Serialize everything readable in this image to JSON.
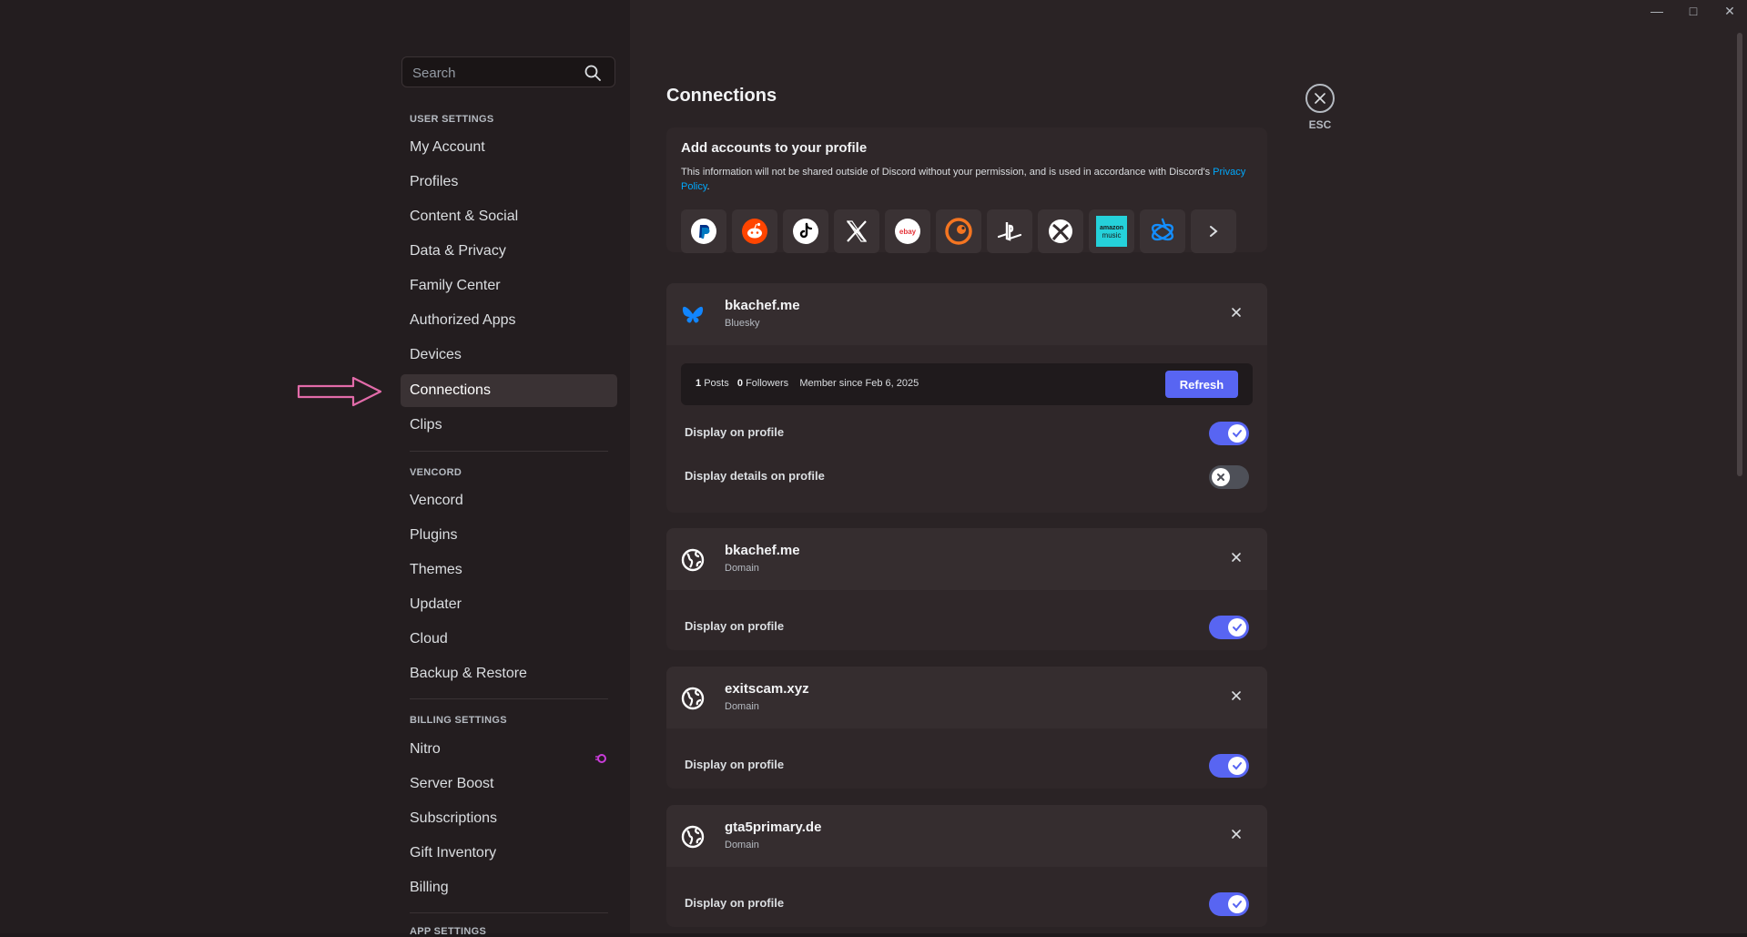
{
  "search": {
    "placeholder": "Search"
  },
  "sidebar": {
    "user_settings_title": "USER SETTINGS",
    "user_items": [
      "My Account",
      "Profiles",
      "Content & Social",
      "Data & Privacy",
      "Family Center",
      "Authorized Apps",
      "Devices",
      "Connections",
      "Clips"
    ],
    "vencord_title": "VENCORD",
    "vencord_items": [
      "Vencord",
      "Plugins",
      "Themes",
      "Updater",
      "Cloud",
      "Backup & Restore"
    ],
    "billing_title": "BILLING SETTINGS",
    "billing_items": [
      "Nitro",
      "Server Boost",
      "Subscriptions",
      "Gift Inventory",
      "Billing"
    ],
    "app_settings_title": "APP SETTINGS",
    "active_item": "Connections"
  },
  "page": {
    "title": "Connections",
    "esc_label": "ESC"
  },
  "add_accounts": {
    "title": "Add accounts to your profile",
    "description": "This information will not be shared outside of Discord without your permission, and is used in accordance with Discord's",
    "privacy_link": "Privacy Policy",
    "period": ".",
    "services": [
      "paypal-icon",
      "reddit-icon",
      "tiktok-icon",
      "x-icon",
      "ebay-icon",
      "crunchyroll-icon",
      "playstation-icon",
      "xbox-icon",
      "amazon-music-icon",
      "battlenet-icon",
      "chevron-right-icon"
    ],
    "ebay_text": "ebay",
    "amazon_text": "amazon",
    "amazon_sub": "music"
  },
  "connections": [
    {
      "name": "bkachef.me",
      "type": "Bluesky",
      "stats": {
        "posts": "1",
        "posts_label": "Posts",
        "followers": "0",
        "followers_label": "Followers",
        "member_since": "Member since Feb 6, 2025"
      },
      "refresh_label": "Refresh",
      "display_on_profile_label": "Display on profile",
      "display_on_profile": true,
      "display_details_label": "Display details on profile",
      "display_details": false
    },
    {
      "name": "bkachef.me",
      "type": "Domain",
      "display_on_profile_label": "Display on profile",
      "display_on_profile": true
    },
    {
      "name": "exitscam.xyz",
      "type": "Domain",
      "display_on_profile_label": "Display on profile",
      "display_on_profile": true
    },
    {
      "name": "gta5primary.de",
      "type": "Domain",
      "display_on_profile_label": "Display on profile",
      "display_on_profile": true
    }
  ],
  "colors": {
    "accent": "#5865f2",
    "link": "#00a8fc",
    "arrow": "#e26ba9",
    "nitro": "#c93cd9"
  }
}
